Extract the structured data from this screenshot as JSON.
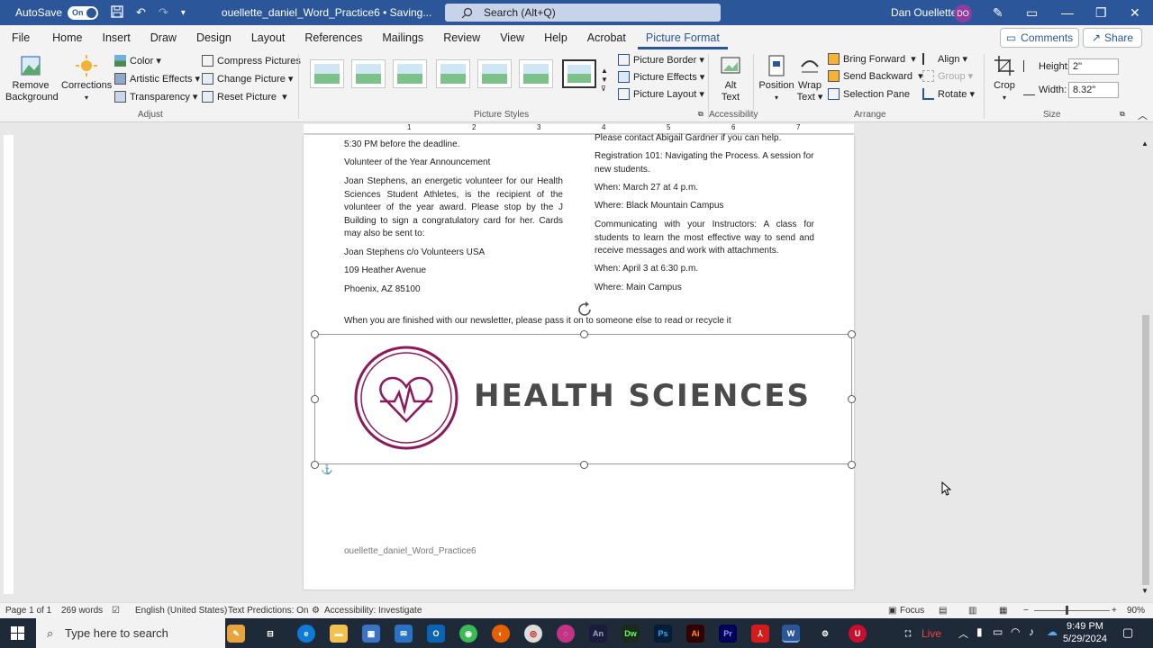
{
  "titlebar": {
    "autosave_label": "AutoSave",
    "autosave_state": "On",
    "filename": "ouellette_daniel_Word_Practice6 • Saving...",
    "search_placeholder": "Search (Alt+Q)",
    "user_name": "Dan Ouellette",
    "user_initials": "DO"
  },
  "menu": {
    "items": [
      "File",
      "Home",
      "Insert",
      "Draw",
      "Design",
      "Layout",
      "References",
      "Mailings",
      "Review",
      "View",
      "Help",
      "Acrobat",
      "Picture Format"
    ],
    "active": "Picture Format",
    "comments_label": "Comments",
    "share_label": "Share"
  },
  "ribbon": {
    "adjust": {
      "remove_background_line1": "Remove",
      "remove_background_line2": "Background",
      "corrections": "Corrections",
      "color": "Color",
      "artistic_effects": "Artistic Effects",
      "transparency": "Transparency",
      "compress_pictures": "Compress Pictures",
      "change_picture": "Change Picture",
      "reset_picture": "Reset Picture",
      "group_label": "Adjust"
    },
    "picture_styles": {
      "picture_border": "Picture Border",
      "picture_effects": "Picture Effects",
      "picture_layout": "Picture Layout",
      "group_label": "Picture Styles"
    },
    "accessibility": {
      "alt_text_line1": "Alt",
      "alt_text_line2": "Text",
      "group_label": "Accessibility"
    },
    "arrange": {
      "position": "Position",
      "wrap_text_line1": "Wrap",
      "wrap_text_line2": "Text",
      "bring_forward": "Bring Forward",
      "send_backward": "Send Backward",
      "selection_pane": "Selection Pane",
      "align": "Align",
      "group": "Group",
      "rotate": "Rotate",
      "group_label": "Arrange"
    },
    "size": {
      "crop": "Crop",
      "height_label": "Height:",
      "height_value": "2\"",
      "width_label": "Width:",
      "width_value": "8.32\"",
      "group_label": "Size"
    }
  },
  "document": {
    "left_col": {
      "p1": "5:30 PM before the deadline.",
      "p2": "Volunteer of the Year Announcement",
      "p3": "Joan Stephens, an energetic volunteer for our Health Sciences Student Athletes, is the recipient of the volunteer of the year award. Please stop by the J Building to sign a congratulatory card for her. Cards may also be sent to:",
      "p4": "Joan Stephens c/o Volunteers USA",
      "p5": "109 Heather Avenue",
      "p6": "Phoenix, AZ 85100"
    },
    "right_col": {
      "p1": "Please contact Abigail Gardner if you can help.",
      "p2": "Registration 101: Navigating the Process. A session for new students.",
      "p3": "When: March 27 at 4 p.m.",
      "p4": "Where: Black Mountain Campus",
      "p5": "Communicating with your Instructors: A class for students to learn the most effective way to send and receive messages and work with attachments.",
      "p6": "When: April 3 at 6:30 p.m.",
      "p7": "Where: Main Campus"
    },
    "closing": "When you are finished with our newsletter, please pass it on to someone else to read or recycle it",
    "logo_text": "HEALTH SCIENCES",
    "footer": "ouellette_daniel_Word_Practice6",
    "ruler_numbers": [
      "1",
      "2",
      "3",
      "4",
      "5",
      "6",
      "7"
    ]
  },
  "statusbar": {
    "page": "Page 1 of 1",
    "words": "269 words",
    "language": "English (United States)",
    "predictions": "Text Predictions: On",
    "accessibility": "Accessibility: Investigate",
    "focus": "Focus",
    "zoom": "90%"
  },
  "taskbar": {
    "search_placeholder": "Type here to search",
    "live_label": "Live",
    "time": "9:49 PM",
    "date": "5/29/2024"
  },
  "colors": {
    "accent": "#2b579a",
    "logo_ring": "#8b1a5c"
  }
}
